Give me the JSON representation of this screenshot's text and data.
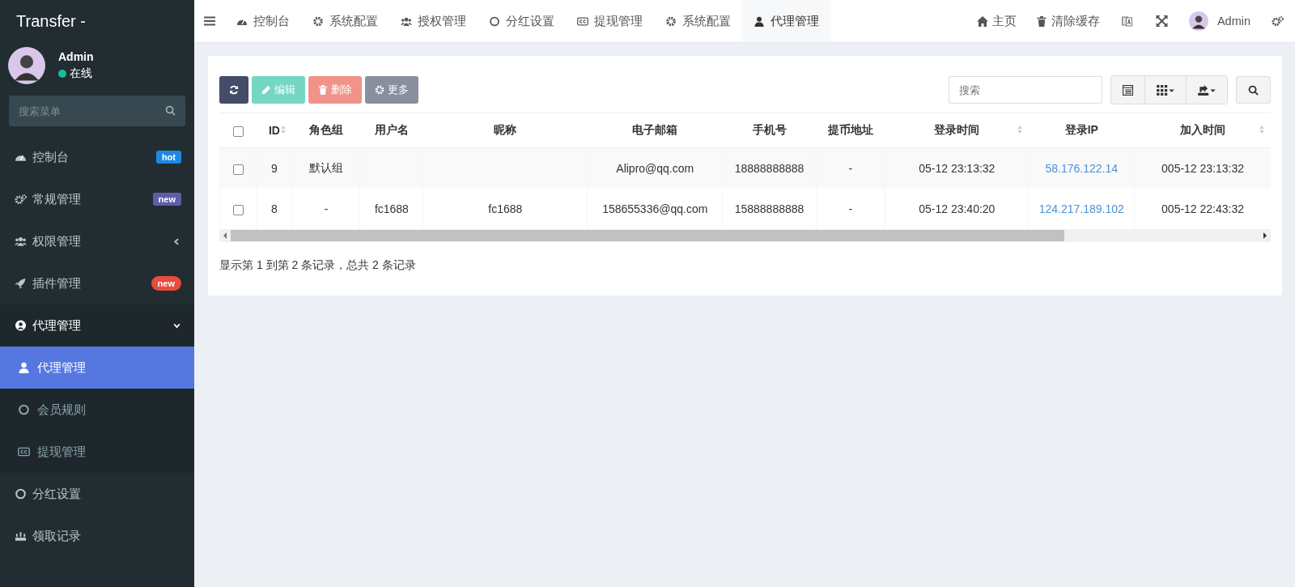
{
  "brand": "Transfer -",
  "user": {
    "name": "Admin",
    "status": "在线",
    "online": true
  },
  "menu_search": {
    "placeholder": "搜索菜单"
  },
  "menu": [
    {
      "label": "控制台",
      "badge": {
        "text": "hot",
        "color": "#1e88e5",
        "kind": "tag"
      }
    },
    {
      "label": "常规管理",
      "badge": {
        "text": "new",
        "color": "#605ca8",
        "kind": "tag"
      }
    },
    {
      "label": "权限管理",
      "expanded": false
    },
    {
      "label": "插件管理",
      "badge": {
        "text": "new",
        "color": "#e74c3c",
        "kind": "pill"
      }
    },
    {
      "label": "代理管理",
      "expanded": true,
      "children": [
        {
          "label": "代理管理",
          "selected": true
        },
        {
          "label": "会员规则",
          "selected": false
        },
        {
          "label": "提现管理",
          "selected": false
        }
      ]
    },
    {
      "label": "分红设置"
    },
    {
      "label": "领取记录"
    }
  ],
  "tabs": [
    {
      "label": "控制台",
      "selected": false
    },
    {
      "label": "系统配置",
      "selected": false
    },
    {
      "label": "授权管理",
      "selected": false
    },
    {
      "label": "分红设置",
      "selected": false
    },
    {
      "label": "提现管理",
      "selected": false
    },
    {
      "label": "系统配置",
      "selected": false
    },
    {
      "label": "代理管理",
      "selected": true
    }
  ],
  "top_right": {
    "home": "主页",
    "clear_cache": "清除缓存",
    "user": "Admin"
  },
  "toolbar": [
    {
      "kind": "refresh",
      "disabled": false
    },
    {
      "kind": "edit",
      "label": "编辑",
      "disabled": true
    },
    {
      "kind": "delete",
      "label": "删除",
      "disabled": true
    },
    {
      "kind": "more",
      "label": "更多",
      "disabled": false
    }
  ],
  "table_search": {
    "placeholder": "搜索"
  },
  "select_all": {
    "checked": false
  },
  "table": {
    "columns": [
      {
        "label": "ID",
        "sortable": true
      },
      {
        "label": "角色组",
        "sortable": false
      },
      {
        "label": "用户名",
        "sortable": false
      },
      {
        "label": "昵称",
        "sortable": false
      },
      {
        "label": "电子邮箱",
        "sortable": false
      },
      {
        "label": "手机号",
        "sortable": false
      },
      {
        "label": "提币地址",
        "sortable": false
      },
      {
        "label": "登录时间",
        "sortable": true
      },
      {
        "label": "登录IP",
        "sortable": false
      },
      {
        "label": "加入时间",
        "sortable": true
      }
    ],
    "rows": [
      {
        "checked": false,
        "cells": [
          "9",
          "默认组",
          "",
          "",
          "Alipro@qq.com",
          "18888888888",
          "-",
          "05-12 23:13:32",
          "58.176.122.14",
          "005-12 23:13:32"
        ]
      },
      {
        "checked": false,
        "cells": [
          "8",
          "-",
          "fc1688",
          "fc1688",
          "158655336@qq.com",
          "15888888888",
          "-",
          "05-12 23:40:20",
          "124.217.189.102",
          "005-12 22:43:32"
        ]
      }
    ]
  },
  "pagination_info": "显示第 1 到第 2 条记录，总共 2 条记录"
}
